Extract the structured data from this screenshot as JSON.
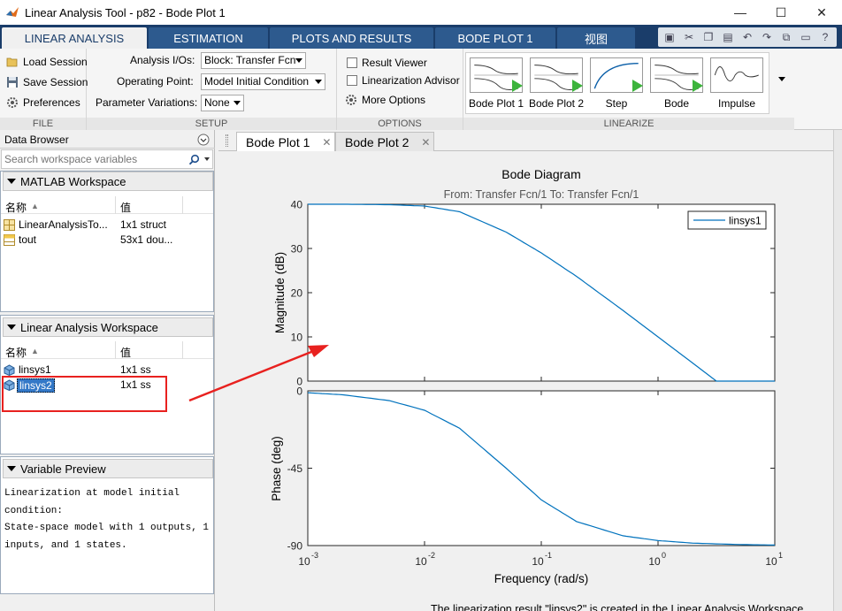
{
  "window": {
    "title": "Linear Analysis Tool - p82 - Bode Plot 1",
    "minimize": "—",
    "maximize": "☐",
    "close": "✕"
  },
  "ribbon_tabs": [
    "LINEAR ANALYSIS",
    "ESTIMATION",
    "PLOTS AND RESULTS",
    "BODE PLOT 1",
    "视图"
  ],
  "ribbon": {
    "file": {
      "label": "FILE",
      "load_session": "Load Session",
      "save_session": "Save Session",
      "preferences": "Preferences"
    },
    "setup": {
      "label": "SETUP",
      "analysis_ios_label": "Analysis I/Os:",
      "analysis_ios_value": "Block: Transfer Fcn",
      "operating_point_label": "Operating Point:",
      "operating_point_value": "Model Initial Condition",
      "param_variations_label": "Parameter Variations:",
      "param_variations_value": "None"
    },
    "options": {
      "label": "OPTIONS",
      "result_viewer": "Result Viewer",
      "linearization_advisor": "Linearization Advisor",
      "more_options": "More Options"
    },
    "linearize": {
      "label": "LINEARIZE",
      "items": [
        "Bode Plot 1",
        "Bode Plot 2",
        "Step",
        "Bode",
        "Impulse"
      ]
    }
  },
  "browser": {
    "title": "Data Browser",
    "search_placeholder": "Search workspace variables",
    "matlab_ws": {
      "title": "MATLAB Workspace",
      "col_name": "名称",
      "col_value": "值",
      "rows": [
        {
          "name": "LinearAnalysisTo...",
          "value": "1x1 struct"
        },
        {
          "name": "tout",
          "value": "53x1 dou..."
        }
      ]
    },
    "linear_ws": {
      "title": "Linear Analysis Workspace",
      "col_name": "名称",
      "col_value": "值",
      "rows": [
        {
          "name": "linsys1",
          "value": "1x1 ss"
        },
        {
          "name": "linsys2",
          "value": "1x1 ss"
        }
      ]
    },
    "preview": {
      "title": "Variable Preview",
      "lines": [
        "Linearization at model initial",
        "condition:",
        "State-space model with 1 outputs, 1",
        "inputs, and 1 states."
      ]
    }
  },
  "doc_tabs": [
    {
      "label": "Bode Plot 1",
      "close": "✕"
    },
    {
      "label": "Bode Plot 2",
      "close": "✕"
    }
  ],
  "status_message": "The linearization result \"linsys2\" is created in the Linear Analysis Workspace",
  "colors": {
    "tab_strip": "#1a3d6a",
    "plot_line": "#0072bd",
    "annotation_red": "#e8211f"
  },
  "chart_data": {
    "type": "line",
    "title": "Bode Diagram",
    "subtitle": "From: Transfer Fcn/1  To: Transfer Fcn/1",
    "xlabel": "Frequency  (rad/s)",
    "xscale": "log",
    "xlim": [
      0.001,
      10
    ],
    "x_ticks": [
      "10",
      "10",
      "10",
      "10",
      "10"
    ],
    "x_tick_exponents": [
      "-3",
      "-2",
      "-1",
      "0",
      "1"
    ],
    "legend": {
      "entries": [
        "linsys1"
      ],
      "placement": "top-right"
    },
    "panels": [
      {
        "ylabel": "Magnitude (dB)",
        "ylim": [
          0,
          40
        ],
        "y_ticks": [
          "0",
          "10",
          "20",
          "30",
          "40"
        ],
        "series": [
          {
            "name": "linsys1",
            "x": [
              0.001,
              0.002,
              0.005,
              0.01,
              0.02,
              0.05,
              0.1,
              0.2,
              0.5,
              1,
              2,
              5,
              10
            ],
            "y": [
              40,
              40,
              39.9,
              39.6,
              38.3,
              33.7,
              29.0,
              23.7,
              16.0,
              10.0,
              4.0,
              -4.0,
              -10.0
            ]
          }
        ]
      },
      {
        "ylabel": "Phase (deg)",
        "ylim": [
          -90,
          0
        ],
        "y_ticks": [
          "0",
          "-45",
          "-90"
        ],
        "series": [
          {
            "name": "linsys1",
            "x": [
              0.001,
              0.002,
              0.005,
              0.01,
              0.02,
              0.05,
              0.1,
              0.2,
              0.5,
              1,
              2,
              5,
              10
            ],
            "y": [
              -1.1,
              -2.3,
              -5.7,
              -11.3,
              -21.8,
              -45.0,
              -63.4,
              -76.0,
              -84.3,
              -87.1,
              -88.6,
              -89.4,
              -89.7
            ]
          }
        ]
      }
    ]
  }
}
